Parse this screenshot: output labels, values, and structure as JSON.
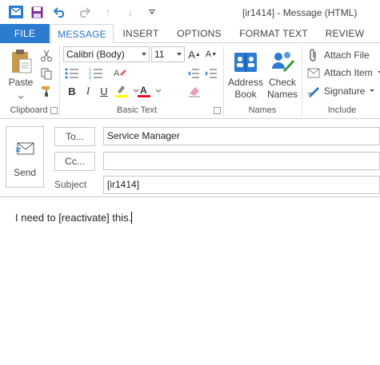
{
  "window": {
    "title": "[ir1414] - Message (HTML)"
  },
  "quick_access": {
    "icons": [
      "outlook-logo-icon",
      "save-icon",
      "undo-icon",
      "redo-icon",
      "up-icon",
      "down-icon",
      "customize-icon"
    ]
  },
  "tabs": [
    {
      "label": "FILE"
    },
    {
      "label": "MESSAGE"
    },
    {
      "label": "INSERT"
    },
    {
      "label": "OPTIONS"
    },
    {
      "label": "FORMAT TEXT"
    },
    {
      "label": "REVIEW"
    }
  ],
  "ribbon": {
    "clipboard": {
      "label": "Clipboard",
      "paste_label": "Paste"
    },
    "basic_text": {
      "label": "Basic Text",
      "font_name": "Calibri (Body)",
      "font_size": "11",
      "bold": "B",
      "italic": "I",
      "underline": "U",
      "font_color": "A"
    },
    "names": {
      "label": "Names",
      "address_book_line1": "Address",
      "address_book_line2": "Book",
      "check_names_line1": "Check",
      "check_names_line2": "Names"
    },
    "include": {
      "label": "Include",
      "attach_file": "Attach File",
      "attach_item": "Attach Item",
      "signature": "Signature"
    }
  },
  "compose": {
    "send_label": "Send",
    "to_button": "To...",
    "cc_button": "Cc...",
    "subject_label": "Subject",
    "to_value": "Service Manager",
    "cc_value": "",
    "subject_value": "[ir1414]"
  },
  "body": {
    "text": "I need to [reactivate] this."
  },
  "colors": {
    "accent": "#2b7bd1",
    "highlight_yellow": "#ffff00",
    "font_red": "#e81123"
  }
}
